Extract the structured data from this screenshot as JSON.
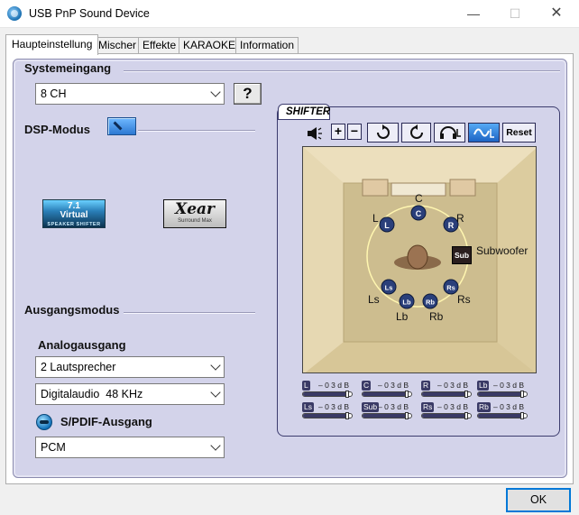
{
  "window": {
    "title": "USB PnP Sound Device",
    "minimize": "—",
    "maximize": "☐",
    "close": "✕"
  },
  "tabs": [
    {
      "label": "Haupteinstellung",
      "active": true
    },
    {
      "label": "Mischer",
      "active": false
    },
    {
      "label": "Effekte",
      "active": false
    },
    {
      "label": "KARAOKE",
      "active": false
    },
    {
      "label": "Information",
      "active": false
    }
  ],
  "system_input": {
    "label": "Systemeingang",
    "value": "8 CH",
    "help": "?"
  },
  "dsp": {
    "label": "DSP-Modus",
    "logo_virtual": {
      "l1": "7.1",
      "l2": "Virtual",
      "l3": "SPEAKER SHIFTER"
    },
    "logo_xear": {
      "main": "Xear",
      "sub": "Surround Max"
    }
  },
  "output": {
    "label": "Ausgangsmodus",
    "analog_label": "Analogausgang",
    "speakers": "2 Lautsprecher",
    "digital": "Digitalaudio  48 KHz",
    "spdif_label": "S/PDIF-Ausgang",
    "spdif_value": "PCM"
  },
  "shifter": {
    "tab": "SHIFTER",
    "reset": "Reset",
    "channels": {
      "C": "C",
      "L": "L",
      "R": "R",
      "Sub": "Sub",
      "Subwoofer": "Subwoofer",
      "Ls": "Ls",
      "Rs": "Rs",
      "Lb": "Lb",
      "Rb": "Rb"
    },
    "meters": [
      {
        "tag": "L",
        "db": "– 0 3  d B",
        "level": 0.9
      },
      {
        "tag": "C",
        "db": "– 0 3  d B",
        "level": 0.9
      },
      {
        "tag": "R",
        "db": "– 0 3  d B",
        "level": 0.9
      },
      {
        "tag": "Lb",
        "db": "– 0 3  d B",
        "level": 0.9
      },
      {
        "tag": "Ls",
        "db": "– 0 3  d B",
        "level": 0.9
      },
      {
        "tag": "Sub",
        "db": "– 0 3  d B",
        "level": 0.9
      },
      {
        "tag": "Rs",
        "db": "– 0 3  d B",
        "level": 0.9
      },
      {
        "tag": "Rb",
        "db": "– 0 3  d B",
        "level": 0.9
      }
    ]
  },
  "ok": "OK"
}
